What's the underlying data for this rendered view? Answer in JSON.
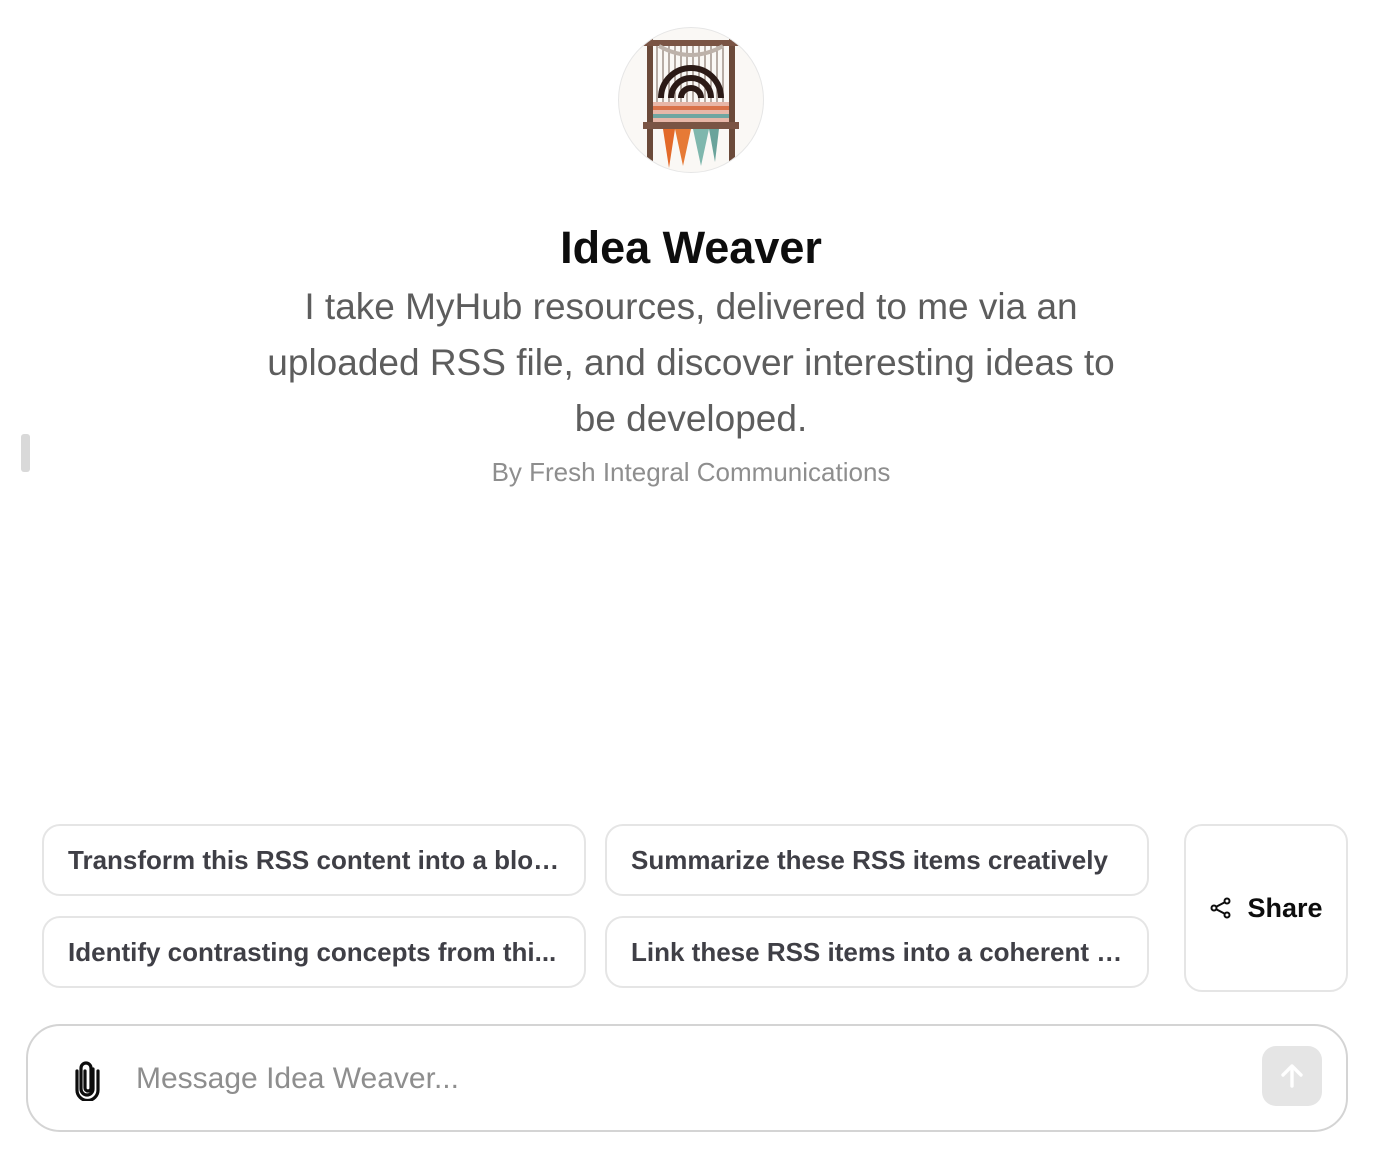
{
  "gpt": {
    "name": "Idea Weaver",
    "description": "I take MyHub resources, delivered to me via an uploaded RSS file, and discover interesting ideas to be developed.",
    "author": "By Fresh Integral Communications",
    "avatar_icon": "loom-rss-logo"
  },
  "starters": [
    {
      "label": "Transform this RSS content into a blog..."
    },
    {
      "label": "Summarize these RSS items creatively"
    },
    {
      "label": "Identify contrasting concepts from thi..."
    },
    {
      "label": "Link these RSS items into a coherent b..."
    }
  ],
  "share": {
    "label": "Share",
    "icon": "share-icon"
  },
  "composer": {
    "placeholder": "Message Idea Weaver...",
    "value": "",
    "attach_icon": "paperclip-icon",
    "send_icon": "arrow-up-icon"
  },
  "colors": {
    "text_primary": "#0d0d0d",
    "text_secondary": "#5d5d5d",
    "text_muted": "#8e8e8e",
    "border": "#e5e5e5",
    "send_disabled_bg": "#e5e5e5"
  }
}
